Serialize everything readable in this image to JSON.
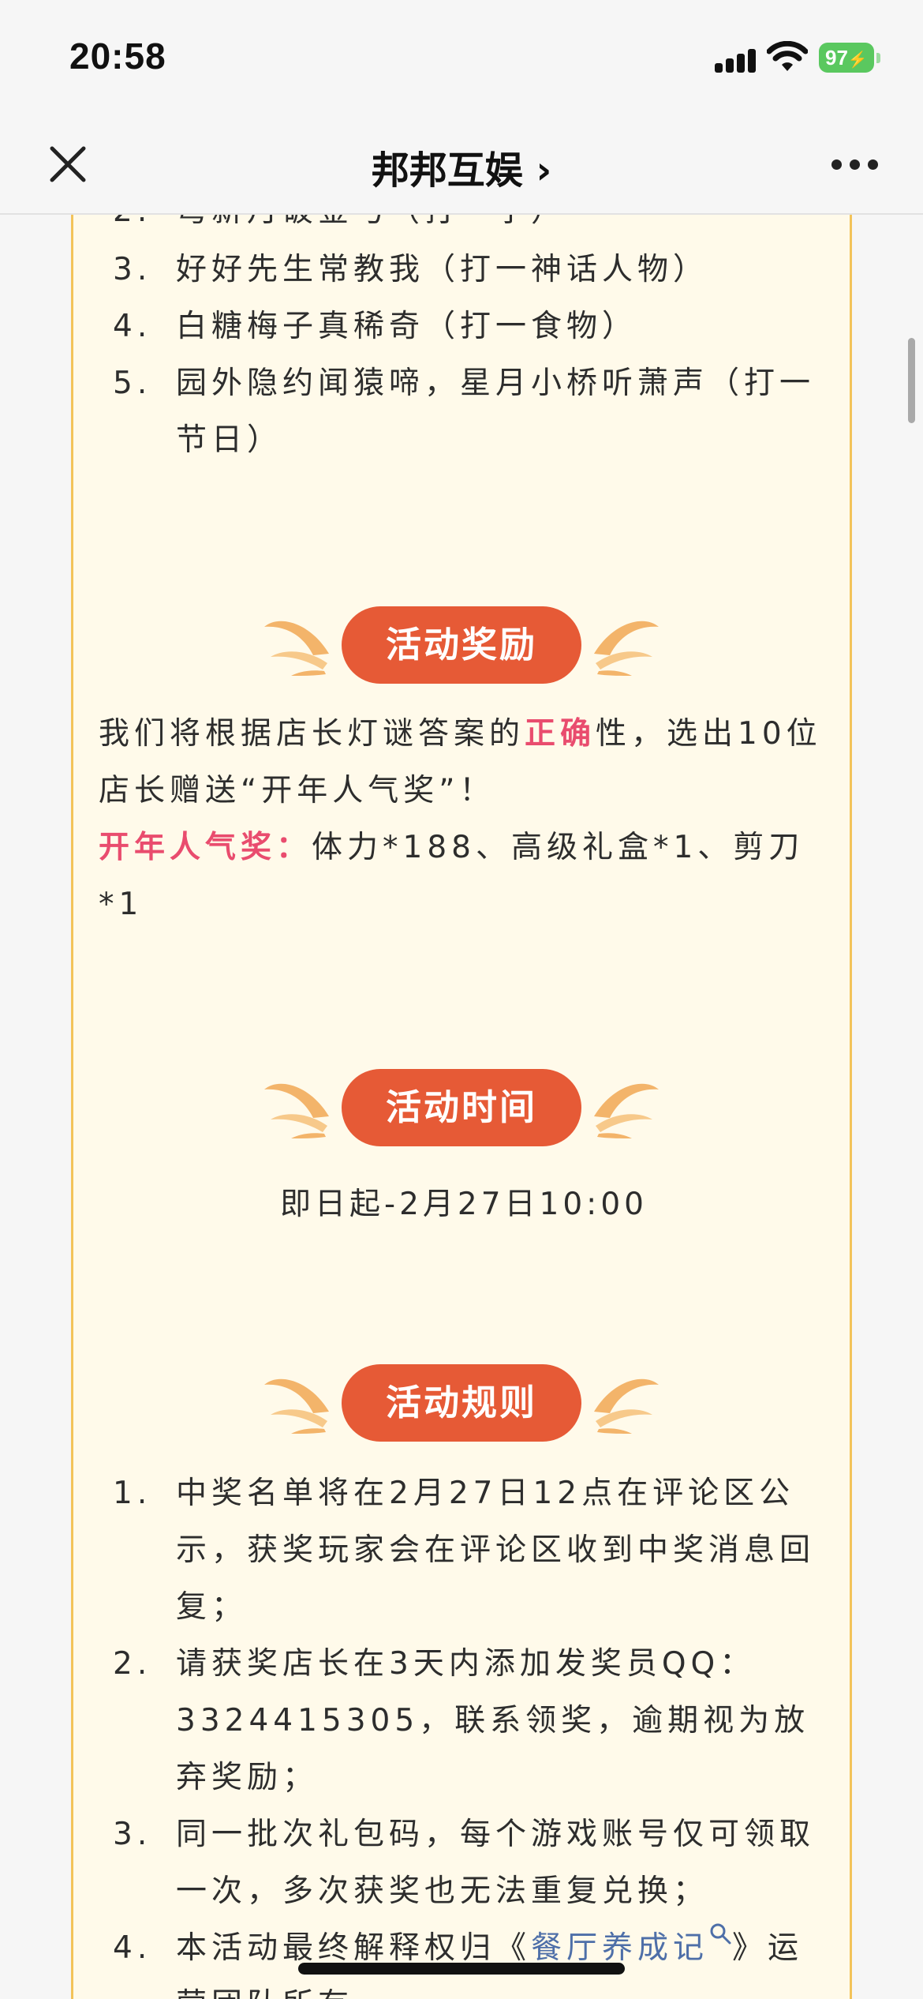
{
  "status_bar": {
    "time": "20:58",
    "battery": "97"
  },
  "nav": {
    "title": "邦邦互娱 ›"
  },
  "riddles": [
    {
      "num": "2.",
      "text": "弯新月破金弓（打一字）"
    },
    {
      "num": "3.",
      "text": "好好先生常教我（打一神话人物）"
    },
    {
      "num": "4.",
      "text": "白糖梅子真稀奇（打一食物）"
    },
    {
      "num": "5.",
      "text": "园外隐约闻猿啼，星月小桥听萧声（打一节日）"
    }
  ],
  "reward": {
    "heading": "活动奖励",
    "text_before": "我们将根据店长灯谜答案的",
    "highlight": "正确",
    "text_after": "性，选出10位店长赠送“开年人气奖”！",
    "prize_label": "开年人气奖：",
    "prize_text": "体力*188、高级礼盒*1、剪刀*1"
  },
  "time_section": {
    "heading": "活动时间",
    "value": "即日起-2月27日10:00"
  },
  "rules": {
    "heading": "活动规则",
    "items": [
      {
        "num": "1.",
        "text": "中奖名单将在2月27日12点在评论区公示，获奖玩家会在评论区收到中奖消息回复；"
      },
      {
        "num": "2.",
        "text": "请获奖店长在3天内添加发奖员QQ：3324415305，联系领奖，逾期视为放弃奖励；"
      },
      {
        "num": "3.",
        "text": "同一批次礼包码，每个游戏账号仅可领取一次，多次获奖也无法重复兑换；"
      }
    ],
    "item4": {
      "num": "4.",
      "prefix": "本活动最终解释权归《",
      "link": "餐厅养成记",
      "suffix": "》运营团队所有。"
    }
  },
  "colors": {
    "accent": "#e65a36",
    "highlight": "#e94c6e",
    "card_bg": "#fffaea",
    "card_border": "#f3c35a",
    "link": "#4e6fa8"
  },
  "icons": [
    "close-icon",
    "more-icon",
    "search-icon",
    "signal-icon",
    "wifi-icon",
    "battery-icon"
  ]
}
